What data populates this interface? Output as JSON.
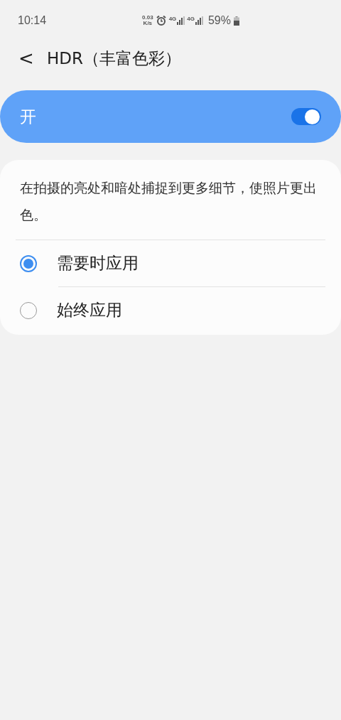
{
  "status_bar": {
    "time": "10:14",
    "net_speed": "0.03",
    "net_unit": "K/s",
    "sims": [
      "4G",
      "4G"
    ],
    "battery": "59%"
  },
  "header": {
    "back": "<",
    "title": "HDR（丰富色彩）"
  },
  "master_switch": {
    "label": "开",
    "on": true
  },
  "description": "在拍摄的亮处和暗处捕捉到更多细节，使照片更出色。",
  "options": [
    {
      "label": "需要时应用",
      "selected": true
    },
    {
      "label": "始终应用",
      "selected": false
    }
  ]
}
